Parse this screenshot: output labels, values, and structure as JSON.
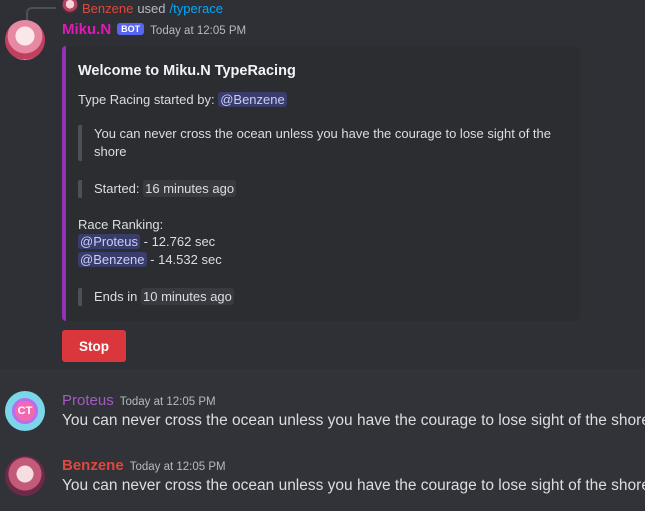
{
  "reply": {
    "username": "Benzene",
    "used": "used",
    "command": "/typerace"
  },
  "messages": [
    {
      "username": "Miku.N",
      "bot_tag": "BOT",
      "timestamp": "Today at 12:05 PM",
      "embed": {
        "title": "Welcome to Miku.N TypeRacing",
        "started_by_label": "Type Racing started by:",
        "started_by_mention": "@Benzene",
        "quote_text": "You can never cross the ocean unless you have the courage to lose sight of the shore",
        "started_label": "Started:",
        "started_value": "16 minutes ago",
        "ranking_label": "Race Ranking:",
        "ranking": [
          {
            "mention": "@Proteus",
            "time": "- 12.762 sec"
          },
          {
            "mention": "@Benzene",
            "time": "- 14.532 sec"
          }
        ],
        "ends_label": "Ends in",
        "ends_value": "10 minutes ago",
        "accent_color": "#9132b8"
      },
      "button_label": "Stop"
    },
    {
      "username": "Proteus",
      "timestamp": "Today at 12:05 PM",
      "text": "You can never cross the ocean unless you have the courage to lose sight of the shore",
      "avatar_text": "CT"
    },
    {
      "username": "Benzene",
      "timestamp": "Today at 12:05 PM",
      "text": "You can never cross the ocean unless you have the courage to lose sight of the shore"
    }
  ],
  "colors": {
    "background": "#313338",
    "embed_bg": "#2b2d31",
    "stop_button": "#da373c",
    "bot_tag": "#5865f2",
    "miku_name": "#e01ab5",
    "proteus_name": "#a659c2",
    "benzene_name": "#e0483d"
  }
}
